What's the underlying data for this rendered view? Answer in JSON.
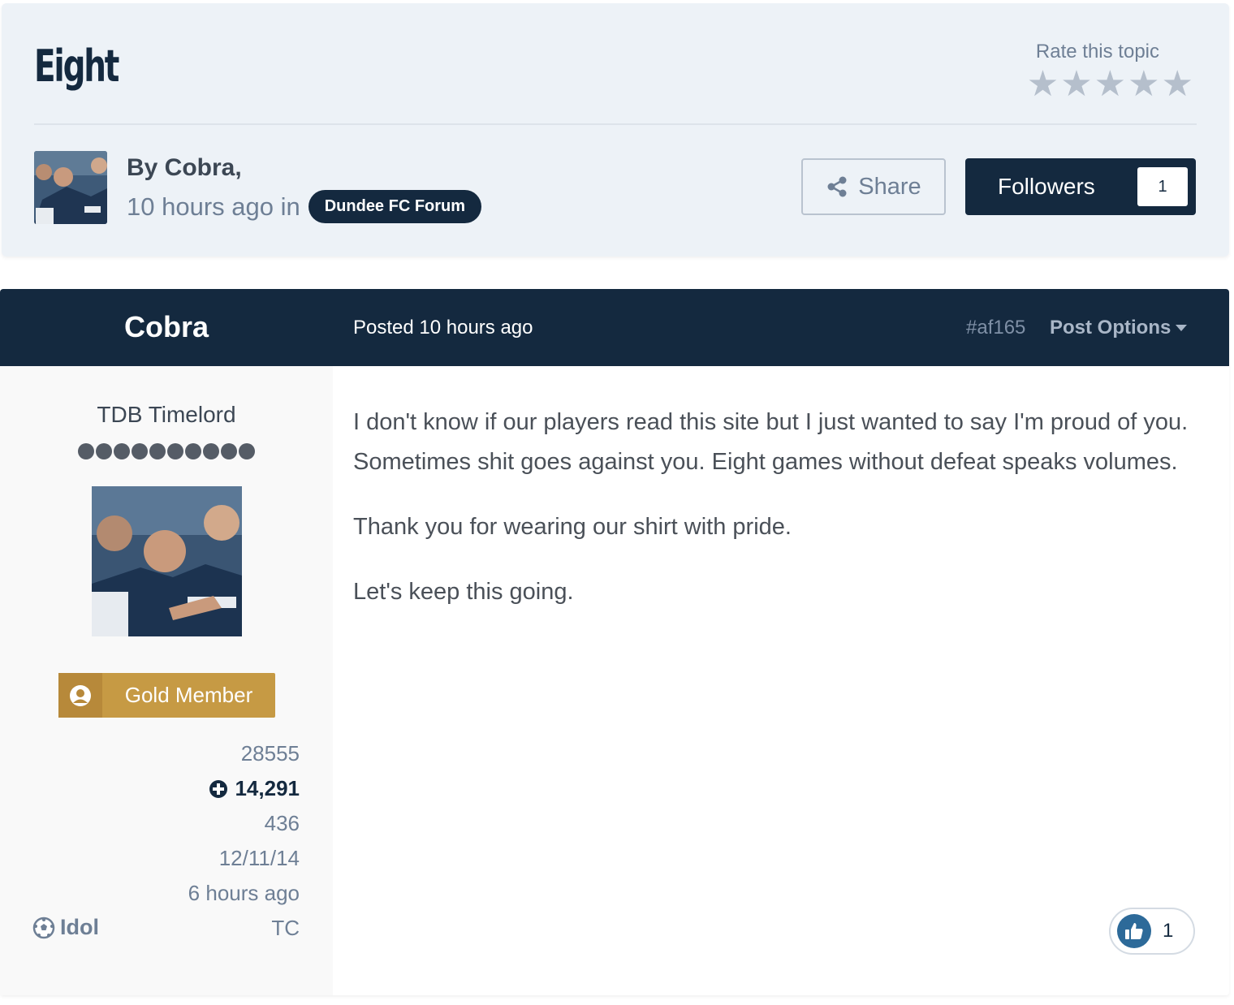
{
  "topic": {
    "title": "Eight",
    "rate_label": "Rate this topic",
    "rating_stars": 5,
    "rating_value": 0,
    "by": "By Cobra,",
    "time": "10 hours ago in",
    "forum": "Dundee FC Forum",
    "share_label": "Share",
    "followers_label": "Followers",
    "followers_count": "1"
  },
  "post": {
    "author": "Cobra",
    "posted": "Posted 10 hours ago",
    "post_id": "#af165",
    "options_label": "Post Options",
    "member_title": "TDB Timelord",
    "rank_pips": 10,
    "group": "Gold Member",
    "stats": {
      "posts": "28555",
      "reputation": "14,291",
      "stat3": "436",
      "joined": "12/11/14",
      "last_visit": "6 hours ago",
      "badge": "Idol",
      "location": "TC"
    },
    "paragraphs": [
      "I don't know if our players read this site but I just wanted to say I'm proud of you. Sometimes shit goes against you. Eight games without defeat speaks volumes.",
      "Thank you for wearing our shirt with pride.",
      "Let's keep this going."
    ],
    "like_count": "1"
  },
  "colors": {
    "header_bg": "#edf2f7",
    "navy": "#14293f",
    "gold": "#c69a44",
    "muted": "#6e7f95",
    "like_blue": "#2d6a99"
  },
  "icons": [
    "star-icon",
    "share-icon",
    "caret-down-icon",
    "user-icon",
    "plus-circle-icon",
    "soccer-ball-icon",
    "thumbs-up-icon"
  ]
}
